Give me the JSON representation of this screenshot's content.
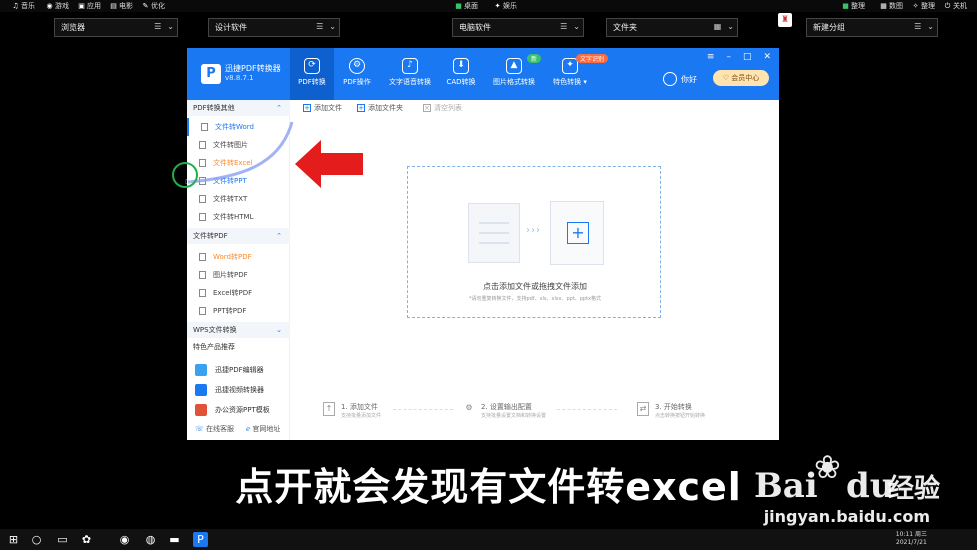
{
  "topbar": {
    "left": [
      "音乐",
      "游戏",
      "应用",
      "电影",
      "优化"
    ],
    "center": [
      "桌面",
      "娱乐"
    ],
    "right": [
      "整理",
      "数图",
      "整理",
      "关机"
    ]
  },
  "fences": [
    {
      "label": "浏览器"
    },
    {
      "label": "设计软件"
    },
    {
      "label": "电脑软件"
    },
    {
      "label": "文件夹"
    },
    {
      "label": "新建分组"
    }
  ],
  "app": {
    "name": "迅捷PDF转换器",
    "version": "v8.8.7.1",
    "tabs": [
      {
        "label": "PDF转换",
        "icon": "refresh-icon"
      },
      {
        "label": "PDF操作",
        "icon": "gear-icon"
      },
      {
        "label": "文字语音转换",
        "icon": "audio-icon"
      },
      {
        "label": "CAD转换",
        "icon": "cad-icon"
      },
      {
        "label": "图片格式转换",
        "icon": "image-icon"
      },
      {
        "label": "特色转换",
        "icon": "magic-icon"
      }
    ],
    "badge_new": "新",
    "badge_ocr": "文字识别",
    "user_name": "你好",
    "vip_label": "会员中心",
    "controls": [
      "≡",
      "–",
      "□",
      "✕"
    ]
  },
  "sidebar": {
    "sections": [
      {
        "title": "PDF转换其他",
        "items": [
          "文件转Word",
          "文件转图片",
          "文件转Excel",
          "文件转PPT",
          "文件转TXT",
          "文件转HTML"
        ]
      },
      {
        "title": "文件转PDF",
        "items": [
          "Word转PDF",
          "图片转PDF",
          "Excel转PDF",
          "PPT转PDF"
        ]
      },
      {
        "title": "WPS文件转换",
        "items": []
      }
    ],
    "products_title": "特色产品推荐",
    "products": [
      "迅捷PDF编辑器",
      "迅捷视频转换器",
      "办公资源PPT模板"
    ],
    "footer": [
      "在线客服",
      "官网地址"
    ]
  },
  "toolbar": {
    "add_file": "添加文件",
    "add_folder": "添加文件夹",
    "clear": "清空列表"
  },
  "dropzone": {
    "title": "点击添加文件或拖拽文件添加",
    "subtitle": "*请勿重复转换文件，支持pdf、xls、xlsx、ppt、pptx格式"
  },
  "steps": [
    {
      "title": "1. 添加文件",
      "sub": "支持批量添加文件"
    },
    {
      "title": "2. 设置输出配置",
      "sub": "支持批量设置文档和转换设置"
    },
    {
      "title": "3. 开始转换",
      "sub": "点击转换按钮开始转换"
    }
  ],
  "overlay": {
    "subtitle": "点开就会发现有文件转excel",
    "watermark_brand": "Bai",
    "watermark_brand2": "du",
    "watermark_cn": "经验",
    "watermark_url": "jingyan.baidu.com"
  },
  "taskbar": {
    "time": "10:11 周三",
    "date": "2021/7/21"
  }
}
